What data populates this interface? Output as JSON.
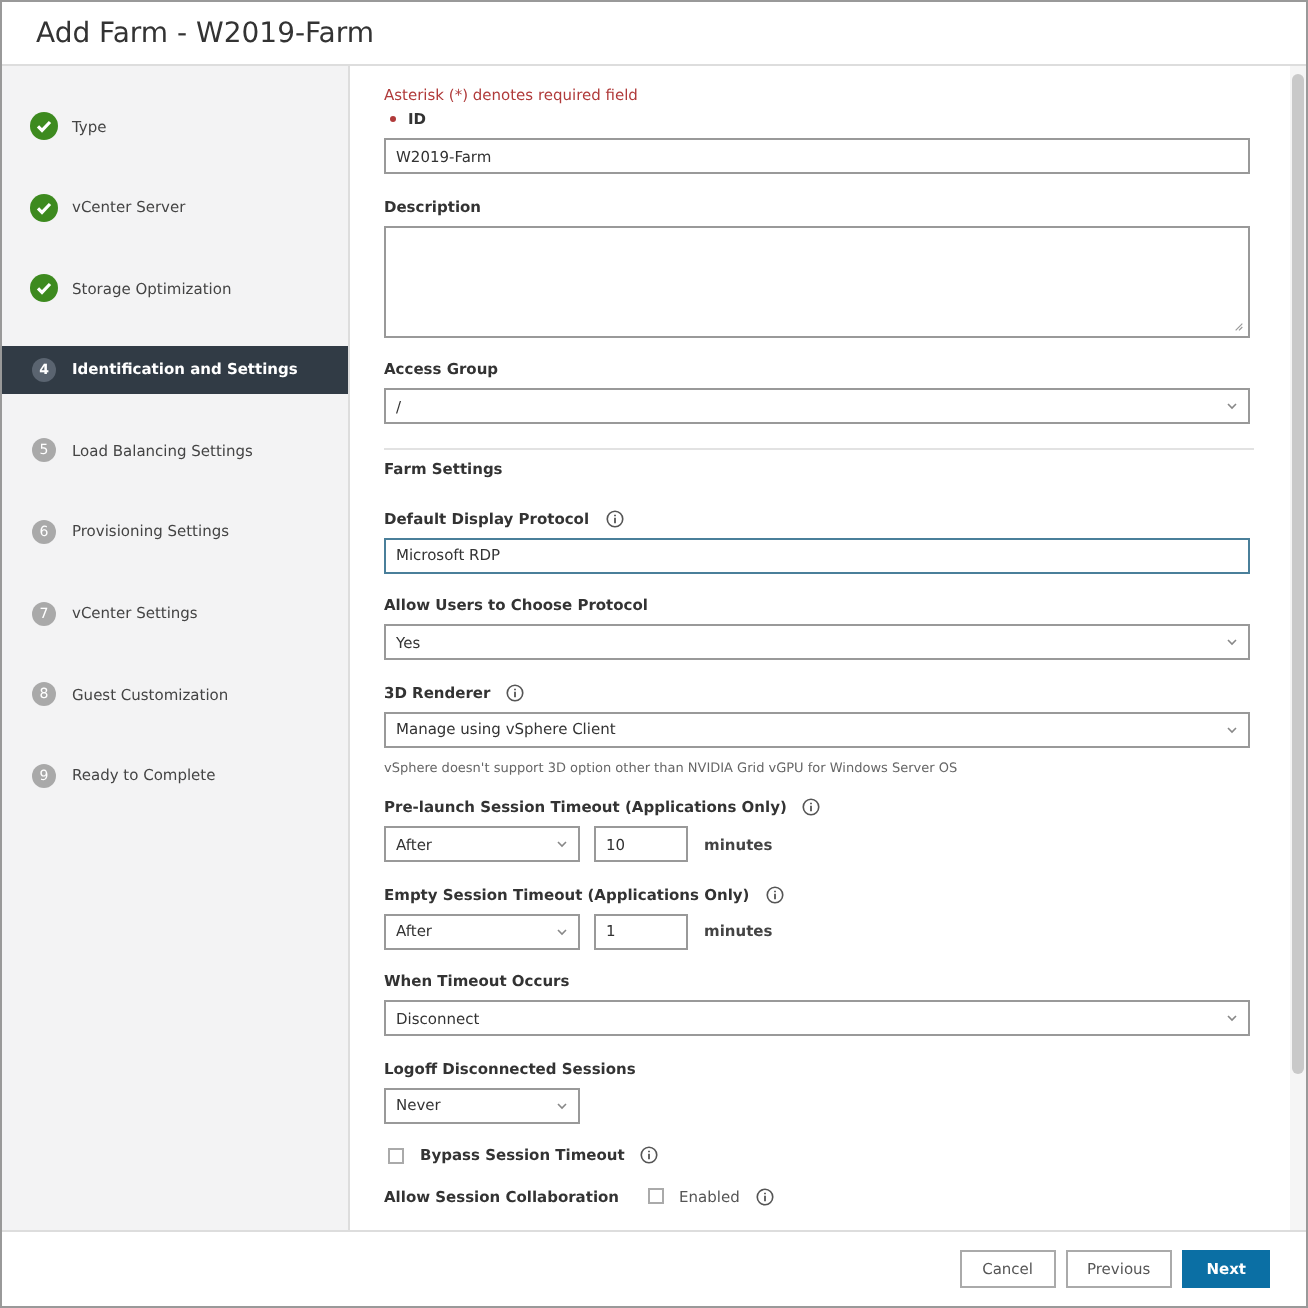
{
  "window": {
    "title": "Add Farm - W2019-Farm"
  },
  "steps": [
    {
      "label": "Type",
      "done": true,
      "selected": false
    },
    {
      "label": "vCenter Server",
      "done": true,
      "selected": false
    },
    {
      "label": "Storage Optimization",
      "done": true,
      "selected": false
    },
    {
      "number": "4",
      "label": "Identification and Settings",
      "done": false,
      "selected": true
    },
    {
      "number": "5",
      "label": "Load Balancing Settings",
      "done": false,
      "selected": false
    },
    {
      "number": "6",
      "label": "Provisioning Settings",
      "done": false,
      "selected": false
    },
    {
      "number": "7",
      "label": "vCenter Settings",
      "done": false,
      "selected": false
    },
    {
      "number": "8",
      "label": "Guest Customization",
      "done": false,
      "selected": false
    },
    {
      "number": "9",
      "label": "Ready to Complete",
      "done": false,
      "selected": false
    }
  ],
  "required_note": "Asterisk (*) denotes required field",
  "fields": [
    {
      "kind": "text",
      "label": "ID",
      "required": true,
      "value": "W2019-Farm"
    },
    {
      "kind": "textarea",
      "label": "Description"
    },
    {
      "kind": "select",
      "label": "Access Group",
      "value": "/"
    },
    {
      "kind": "heading",
      "label": "Farm Settings"
    },
    {
      "kind": "text",
      "label": "Default Display Protocol",
      "info": true,
      "focused": true,
      "value": "Microsoft RDP"
    },
    {
      "kind": "select",
      "label": "Allow Users to Choose Protocol",
      "value": "Yes"
    },
    {
      "kind": "select",
      "label": "3D Renderer",
      "info": true,
      "value": "Manage using vSphere Client",
      "help": "vSphere doesn't support 3D option other than NVIDIA Grid vGPU for Windows Server OS"
    },
    {
      "kind": "timeout",
      "label": "Pre-launch Session Timeout (Applications Only)",
      "info": true,
      "value": "After",
      "amount": "10",
      "unit": "minutes"
    },
    {
      "kind": "timeout",
      "label": "Empty Session Timeout (Applications Only)",
      "info": true,
      "value": "After",
      "amount": "1",
      "unit": "minutes"
    },
    {
      "kind": "select",
      "label": "When Timeout Occurs",
      "value": "Disconnect"
    },
    {
      "kind": "short-select",
      "label": "Logoff Disconnected Sessions",
      "value": "Never"
    },
    {
      "kind": "checkbox",
      "label": "Bypass Session Timeout",
      "info": true,
      "checked": false
    },
    {
      "kind": "inline-checkbox",
      "label": "Allow Session Collaboration",
      "option": "Enabled",
      "info": true,
      "checked": false
    }
  ],
  "buttons": [
    {
      "label": "Cancel",
      "primary": false
    },
    {
      "label": "Previous",
      "primary": false
    },
    {
      "label": "Next",
      "primary": true
    }
  ]
}
